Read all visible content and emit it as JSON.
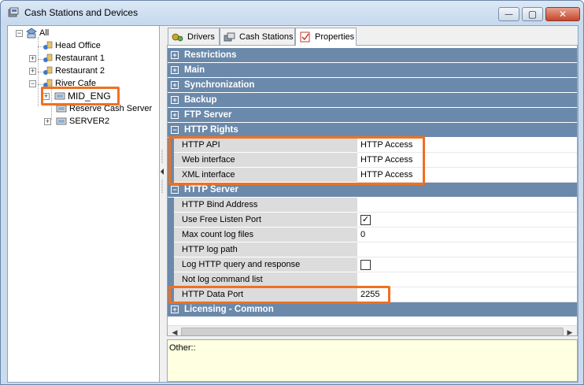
{
  "window": {
    "title": "Cash Stations and Devices",
    "close_glyph": "✕",
    "max_glyph": "▢",
    "min_glyph": "—"
  },
  "tree": {
    "root": "All",
    "nodes": [
      {
        "label": "Head Office"
      },
      {
        "label": "Restaurant 1"
      },
      {
        "label": "Restaurant 2"
      },
      {
        "label": "River Cafe"
      },
      {
        "label": "MID_ENG"
      },
      {
        "label": "Reserve Cash Server"
      },
      {
        "label": "SERVER2"
      }
    ]
  },
  "tabs": [
    {
      "label": "Drivers",
      "icon": "drivers-icon"
    },
    {
      "label": "Cash Stations",
      "icon": "cash-stations-icon"
    },
    {
      "label": "Properties",
      "icon": "properties-icon"
    }
  ],
  "categories": {
    "restrictions": "Restrictions",
    "main": "Main",
    "synchronization": "Synchronization",
    "backup": "Backup",
    "ftp_server": "FTP Server",
    "http_rights": "HTTP Rights",
    "http_server": "HTTP Server",
    "licensing": "Licensing - Common"
  },
  "http_rights": [
    {
      "name": "HTTP API",
      "value": "HTTP Access"
    },
    {
      "name": "Web interface",
      "value": "HTTP Access"
    },
    {
      "name": "XML interface",
      "value": "HTTP Access"
    }
  ],
  "http_server": [
    {
      "name": "HTTP Bind Address",
      "value": ""
    },
    {
      "name": "Use Free Listen Port",
      "value": "✓"
    },
    {
      "name": "Max count log files",
      "value": "0"
    },
    {
      "name": "HTTP log path",
      "value": ""
    },
    {
      "name": "Log HTTP query and response",
      "value": ""
    },
    {
      "name": "Not log command list",
      "value": ""
    },
    {
      "name": "HTTP Data Port",
      "value": "2255"
    }
  ],
  "description": "Other::",
  "colors": {
    "category_band": "#6b89aa",
    "highlight": "#f07020"
  }
}
